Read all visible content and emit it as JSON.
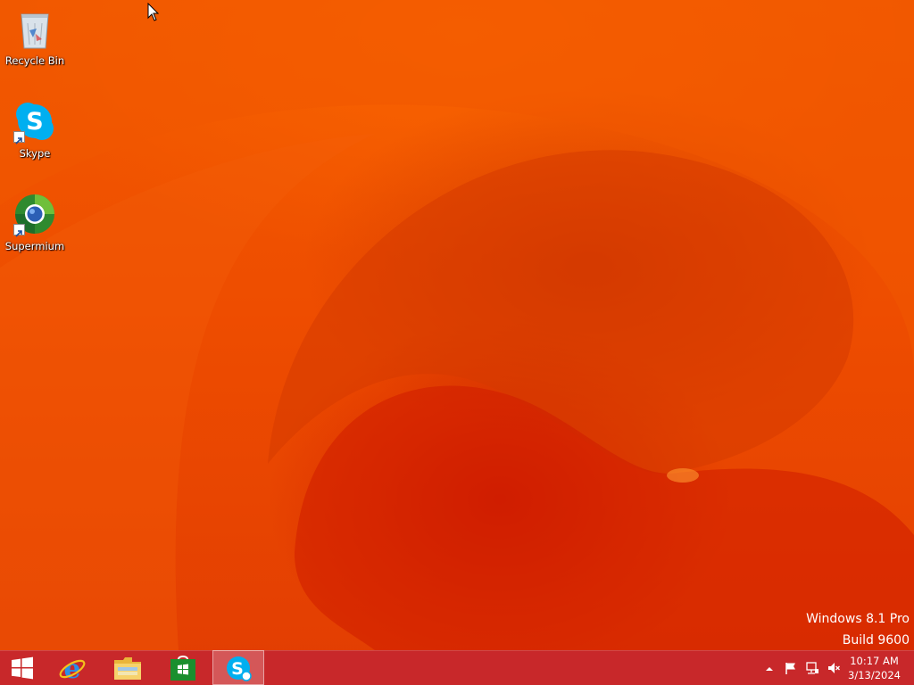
{
  "desktop": {
    "icons": [
      {
        "label": "Recycle Bin",
        "icon": "recycle-bin-icon"
      },
      {
        "label": "Skype",
        "icon": "skype-icon"
      },
      {
        "label": "Supermium",
        "icon": "supermium-icon"
      }
    ]
  },
  "watermark": {
    "edition": "Windows 8.1 Pro",
    "build": "Build 9600"
  },
  "taskbar": {
    "pinned": [
      {
        "name": "start-button",
        "icon": "windows-logo-icon"
      },
      {
        "name": "internet-explorer",
        "icon": "internet-explorer-icon"
      },
      {
        "name": "file-explorer",
        "icon": "folder-icon"
      },
      {
        "name": "store",
        "icon": "store-icon"
      },
      {
        "name": "skype",
        "icon": "skype-icon",
        "active": true
      }
    ],
    "tray": {
      "icons": [
        "show-hidden-icons-chevron-icon",
        "action-center-flag-icon",
        "network-icon",
        "volume-muted-icon"
      ],
      "time": "10:17 AM",
      "date": "3/13/2024"
    }
  },
  "colors": {
    "wallpaper": "#ee4d00",
    "taskbar": "#c8282a",
    "skype": "#00aff0",
    "store": "#1a8f2e"
  }
}
